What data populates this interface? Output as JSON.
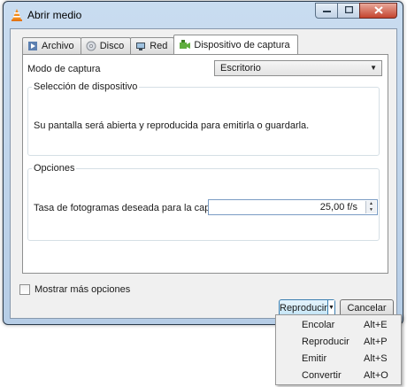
{
  "window": {
    "title": "Abrir medio",
    "app_icon": "vlc-cone-icon"
  },
  "caption_buttons": {
    "minimize": "minimize-icon",
    "maximize": "maximize-icon",
    "close": "close-icon"
  },
  "tabs": [
    {
      "label": "Archivo",
      "icon": "file-icon"
    },
    {
      "label": "Disco",
      "icon": "disc-icon"
    },
    {
      "label": "Red",
      "icon": "network-icon"
    },
    {
      "label": "Dispositivo de captura",
      "icon": "capture-device-icon",
      "active": true
    }
  ],
  "capture": {
    "mode_label": "Modo de captura",
    "mode_value": "Escritorio"
  },
  "device_group": {
    "title": "Selección de dispositivo",
    "text": "Su pantalla será abierta y reproducida para emitirla o guardarla."
  },
  "options_group": {
    "title": "Opciones",
    "rate_label": "Tasa de fotogramas deseada para la captura.",
    "rate_value": "25,00 f/s"
  },
  "more_options": {
    "label": "Mostrar más opciones",
    "checked": false
  },
  "buttons": {
    "play": "Reproducir",
    "cancel": "Cancelar"
  },
  "menu": [
    {
      "label": "Encolar",
      "shortcut": "Alt+E"
    },
    {
      "label": "Reproducir",
      "shortcut": "Alt+P"
    },
    {
      "label": "Emitir",
      "shortcut": "Alt+S"
    },
    {
      "label": "Convertir",
      "shortcut": "Alt+O"
    }
  ]
}
